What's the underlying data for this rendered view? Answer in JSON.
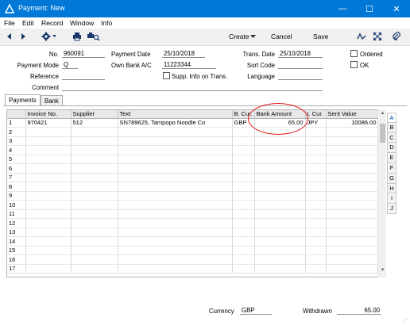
{
  "window": {
    "title": "Payment: New",
    "minimize": "—",
    "maximize": "☐",
    "close": "✕",
    "accent": "#0078d7"
  },
  "menu": [
    "File",
    "Edit",
    "Record",
    "Window",
    "Info"
  ],
  "toolbar": {
    "create": "Create",
    "cancel": "Cancel",
    "save": "Save"
  },
  "form": {
    "no_label": "No.",
    "no_value": "960091",
    "payment_mode_label": "Payment Mode",
    "payment_mode_value": "Q",
    "reference_label": "Reference",
    "reference_value": "",
    "comment_label": "Comment",
    "comment_value": "",
    "payment_date_label": "Payment Date",
    "payment_date_value": "25/10/2018",
    "own_bank_label": "Own Bank A/C",
    "own_bank_value": "11223344",
    "supp_info_label": "Supp. Info on Trans.",
    "trans_date_label": "Trans. Date",
    "trans_date_value": "25/10/2018",
    "sort_code_label": "Sort Code",
    "sort_code_value": "",
    "language_label": "Language",
    "language_value": "",
    "ordered_label": "Ordered",
    "ok_label": "OK"
  },
  "tabs": [
    "Payments",
    "Bank"
  ],
  "grid": {
    "columns": [
      "",
      "Invoice No.",
      "Supplier",
      "Text",
      "B. Cur.",
      "Bank Amount",
      "I. Cur.",
      "Sent Value"
    ],
    "rows": [
      [
        "1",
        "970421",
        "512",
        "SN789625, Tampopo Noodle Co",
        "GBP",
        "65.00",
        "JPY",
        "10086.00"
      ],
      [
        "2",
        "",
        "",
        "",
        "",
        "",
        "",
        ""
      ],
      [
        "3",
        "",
        "",
        "",
        "",
        "",
        "",
        ""
      ],
      [
        "4",
        "",
        "",
        "",
        "",
        "",
        "",
        ""
      ],
      [
        "5",
        "",
        "",
        "",
        "",
        "",
        "",
        ""
      ],
      [
        "6",
        "",
        "",
        "",
        "",
        "",
        "",
        ""
      ],
      [
        "7",
        "",
        "",
        "",
        "",
        "",
        "",
        ""
      ],
      [
        "8",
        "",
        "",
        "",
        "",
        "",
        "",
        ""
      ],
      [
        "9",
        "",
        "",
        "",
        "",
        "",
        "",
        ""
      ],
      [
        "10",
        "",
        "",
        "",
        "",
        "",
        "",
        ""
      ],
      [
        "11",
        "",
        "",
        "",
        "",
        "",
        "",
        ""
      ],
      [
        "12",
        "",
        "",
        "",
        "",
        "",
        "",
        ""
      ],
      [
        "13",
        "",
        "",
        "",
        "",
        "",
        "",
        ""
      ],
      [
        "14",
        "",
        "",
        "",
        "",
        "",
        "",
        ""
      ],
      [
        "15",
        "",
        "",
        "",
        "",
        "",
        "",
        ""
      ],
      [
        "16",
        "",
        "",
        "",
        "",
        "",
        "",
        ""
      ],
      [
        "17",
        "",
        "",
        "",
        "",
        "",
        "",
        ""
      ]
    ]
  },
  "letters": [
    "A",
    "B",
    "C",
    "D",
    "E",
    "F",
    "G",
    "H",
    "I",
    "J"
  ],
  "footer": {
    "currency_label": "Currency",
    "currency_value": "GBP",
    "withdrawn_label": "Withdrawn",
    "withdrawn_value": "65.00"
  }
}
